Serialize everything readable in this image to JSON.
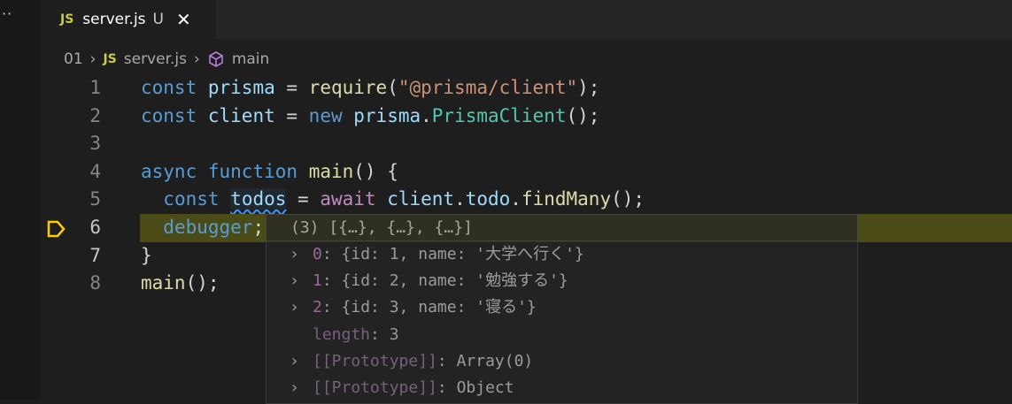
{
  "tab": {
    "icon": "js-file-icon",
    "badge": "JS",
    "name": "server.js",
    "status": "U"
  },
  "breadcrumb": {
    "folder": "01",
    "file": "server.js",
    "symbol": "main"
  },
  "lines": [
    {
      "n": "1",
      "tokens": [
        [
          "const",
          "k"
        ],
        [
          " ",
          "p"
        ],
        [
          "prisma",
          "v"
        ],
        [
          " = ",
          "p"
        ],
        [
          "require",
          "f"
        ],
        [
          "(",
          "p"
        ],
        [
          "\"@prisma/client\"",
          "s"
        ],
        [
          ");",
          "p"
        ]
      ]
    },
    {
      "n": "2",
      "tokens": [
        [
          "const",
          "k"
        ],
        [
          " ",
          "p"
        ],
        [
          "client",
          "v"
        ],
        [
          " = ",
          "p"
        ],
        [
          "new",
          "k"
        ],
        [
          " ",
          "p"
        ],
        [
          "prisma",
          "v"
        ],
        [
          ".",
          "p"
        ],
        [
          "PrismaClient",
          "c"
        ],
        [
          "();",
          "p"
        ]
      ]
    },
    {
      "n": "3",
      "tokens": []
    },
    {
      "n": "4",
      "tokens": [
        [
          "async",
          "k"
        ],
        [
          " ",
          "p"
        ],
        [
          "function",
          "k"
        ],
        [
          " ",
          "p"
        ],
        [
          "main",
          "f"
        ],
        [
          "() {",
          "p"
        ]
      ]
    },
    {
      "n": "5",
      "tokens": [
        [
          "  ",
          "p"
        ],
        [
          "const",
          "k"
        ],
        [
          " ",
          "p"
        ],
        [
          "todos",
          "v squig"
        ],
        [
          " = ",
          "p"
        ],
        [
          "await",
          "kw"
        ],
        [
          " ",
          "p"
        ],
        [
          "client",
          "v"
        ],
        [
          ".",
          "p"
        ],
        [
          "todo",
          "v"
        ],
        [
          ".",
          "p"
        ],
        [
          "findMany",
          "f"
        ],
        [
          "();",
          "p"
        ]
      ]
    },
    {
      "n": "6",
      "tokens": [
        [
          "  ",
          "p"
        ],
        [
          "debugger",
          "k"
        ],
        [
          ";",
          "p"
        ]
      ],
      "paused": true
    },
    {
      "n": "7",
      "tokens": [
        [
          "}",
          "p"
        ]
      ]
    },
    {
      "n": "8",
      "tokens": [
        [
          "main",
          "f"
        ],
        [
          "();",
          "p"
        ]
      ]
    }
  ],
  "hover": {
    "summary": "(3) [{…}, {…}, {…}]",
    "rows": [
      {
        "expand": true,
        "key": "0",
        "value": "{id: 1, name: '大学へ行く'}"
      },
      {
        "expand": true,
        "key": "1",
        "value": "{id: 2, name: '勉強する'}"
      },
      {
        "expand": true,
        "key": "2",
        "value": "{id: 3, name: '寝る'}"
      },
      {
        "expand": false,
        "key": "length",
        "value": "3",
        "dim": true,
        "num": true
      },
      {
        "expand": true,
        "key": "[[Prototype]]",
        "value": "Array(0)",
        "dim": true
      },
      {
        "expand": true,
        "key": "[[Prototype]]",
        "value": "Object",
        "dim": true
      }
    ]
  },
  "colors": {
    "debug_line": "#4b4b18",
    "paused_arrow": "#ffcc00"
  }
}
